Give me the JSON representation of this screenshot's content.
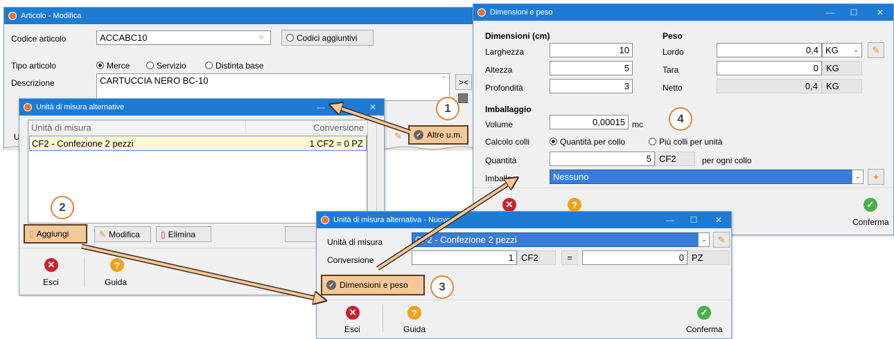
{
  "articolo": {
    "title": "Articolo - Modifica",
    "codice_label": "Codice articolo",
    "codice_value": "ACCABC10",
    "codici_aggiuntivi": "Codici aggiuntivi",
    "tipo_label": "Tipo articolo",
    "tipo_options": [
      "Merce",
      "Servizio",
      "Distinta base"
    ],
    "descrizione_label": "Descrizione",
    "descrizione_value": "CARTUCCIA NERO BC-10",
    "u_label": "U",
    "altre_um": "Altre u.m."
  },
  "um_list": {
    "title": "Unità di misura alternative",
    "col_unit": "Unità di misura",
    "col_conv": "Conversione",
    "rows": [
      {
        "unit": "CF2 - Confezione 2 pezzi",
        "conv": "1 CF2 = 0 PZ"
      }
    ],
    "aggiungi": "Aggiungi",
    "modifica": "Modifica",
    "elimina": "Elimina",
    "esci": "Esci",
    "guida": "Guida"
  },
  "um_nuovo": {
    "title": "Unità di misura alternativa - Nuovo",
    "unita_label": "Unità di misura",
    "unita_value": "CF2 - Confezione 2 pezzi",
    "conv_label": "Conversione",
    "conv_left": "1",
    "conv_left_unit": "CF2",
    "equals": "=",
    "conv_right": "0",
    "conv_right_unit": "PZ",
    "dimensioni_btn": "Dimensioni e peso",
    "esci": "Esci",
    "guida": "Guida",
    "conferma": "Conferma"
  },
  "dim": {
    "title": "Dimensioni e peso",
    "dim_header": "Dimensioni (cm)",
    "larghezza_label": "Larghezza",
    "larghezza": "10",
    "altezza_label": "Altezza",
    "altezza": "5",
    "profondita_label": "Profondità",
    "profondita": "3",
    "peso_header": "Peso",
    "lordo_label": "Lordo",
    "lordo": "0,4",
    "lordo_unit": "KG",
    "tara_label": "Tara",
    "tara": "0",
    "tara_unit": "KG",
    "netto_label": "Netto",
    "netto": "0,4",
    "netto_unit": "KG",
    "imballaggio_header": "Imballaggio",
    "volume_label": "Volume",
    "volume": "0,00015",
    "volume_unit": "mc",
    "calcolo_label": "Calcolo colli",
    "calcolo_opt1": "Quantità per collo",
    "calcolo_opt2": "Più colli per unità",
    "quantita_label": "Quantità",
    "quantita": "5",
    "quantita_unit": "CF2",
    "per_collo": "per ogni collo",
    "imballo_label": "Imballo",
    "imballo_value": "Nessuno",
    "conferma": "Conferma"
  },
  "badges": [
    "1",
    "2",
    "3",
    "4"
  ]
}
